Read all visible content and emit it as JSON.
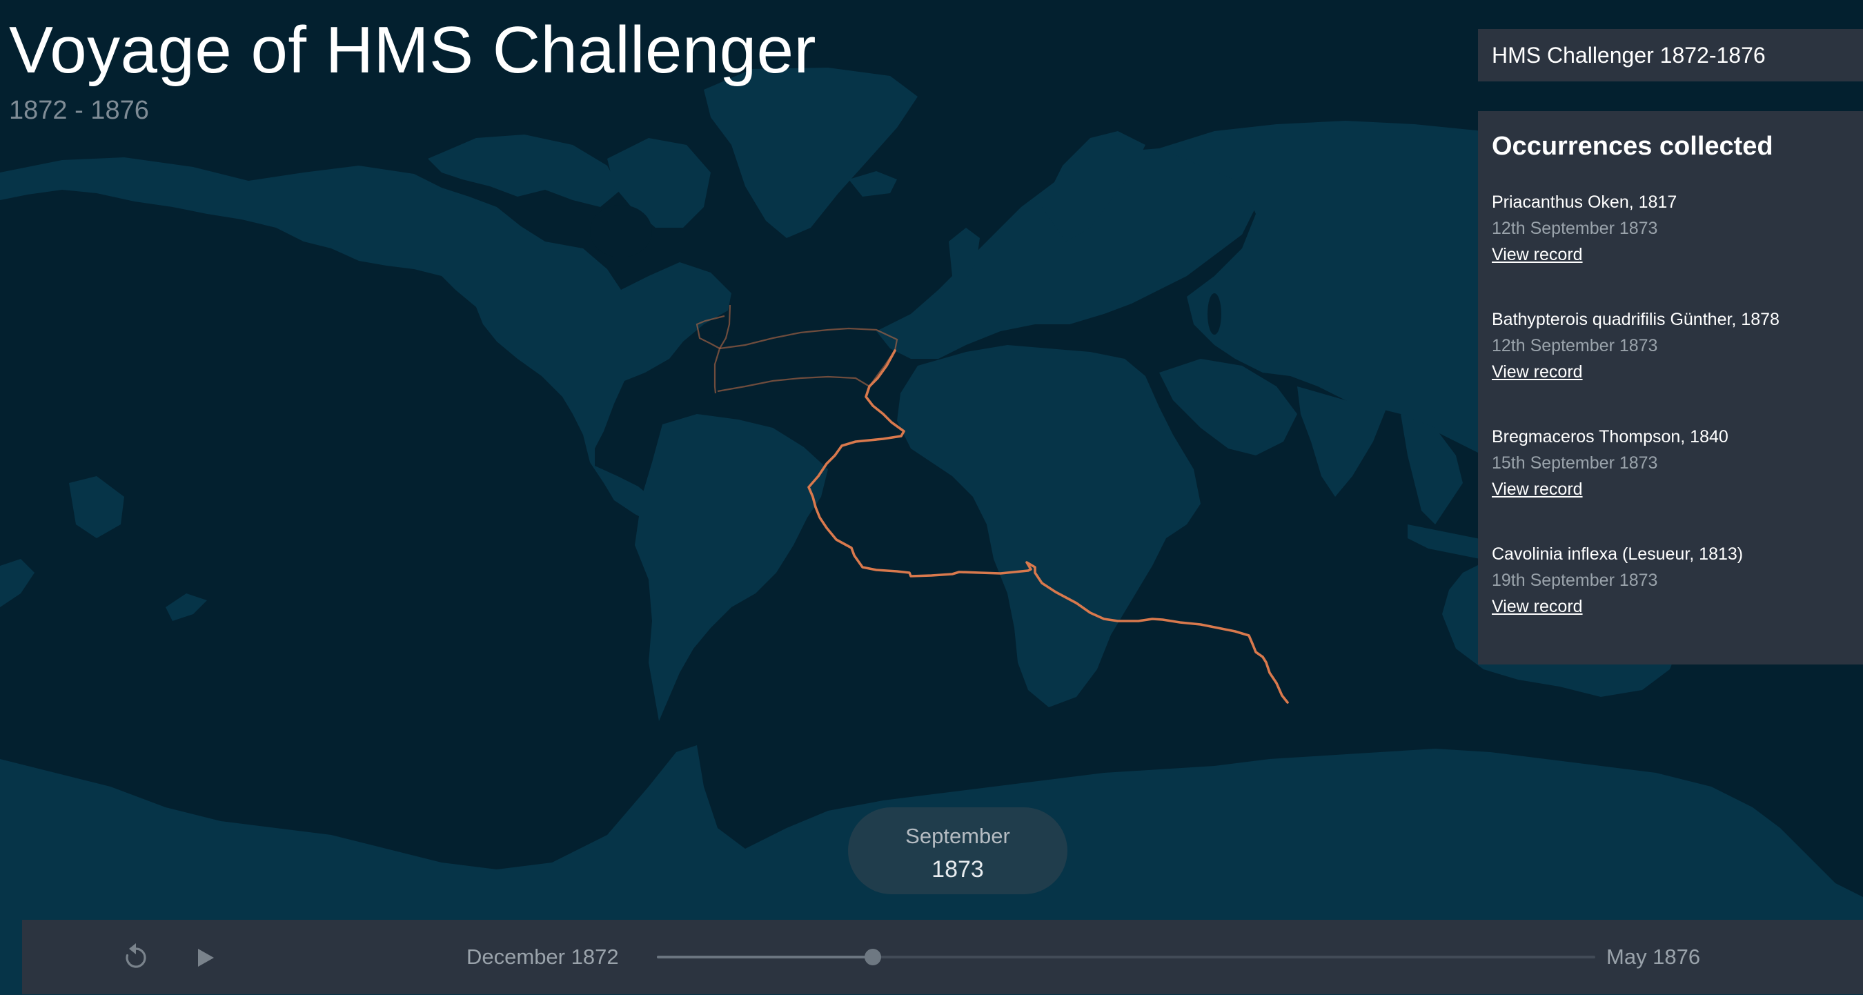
{
  "header": {
    "title": "Voyage of HMS Challenger",
    "subtitle": "1872 - 1876"
  },
  "voyage_selector": {
    "label": "HMS Challenger 1872-1876"
  },
  "occurrences": {
    "heading": "Occurrences collected",
    "items": [
      {
        "name": "Priacanthus Oken, 1817",
        "date": "12th September 1873",
        "link": "View record"
      },
      {
        "name": "Bathypterois quadrifilis Günther, 1878",
        "date": "12th September 1873",
        "link": "View record"
      },
      {
        "name": "Bregmaceros Thompson, 1840",
        "date": "15th September 1873",
        "link": "View record"
      },
      {
        "name": "Cavolinia inflexa (Lesueur, 1813)",
        "date": "19th September 1873",
        "link": "View record"
      }
    ]
  },
  "current_date": {
    "month": "September",
    "year": "1873"
  },
  "timeline": {
    "start_label": "December 1872",
    "end_label": "May 1876",
    "progress": 0.23,
    "replay_icon": "replay-icon",
    "play_icon": "play-icon"
  },
  "colors": {
    "ocean": "#03202f",
    "land": "#063448",
    "track": "#d9794d",
    "panel": "#2c3440"
  }
}
